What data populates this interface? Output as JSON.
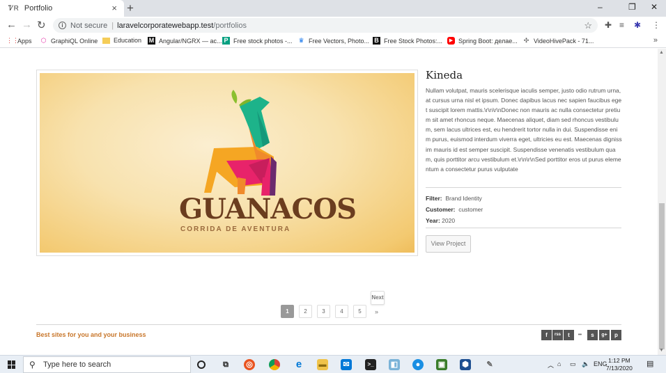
{
  "browser": {
    "tab_title": "Portfolio",
    "tab_close": "×",
    "new_tab": "+",
    "window_controls": [
      "–",
      "❐",
      "✕"
    ],
    "nav": {
      "back": "←",
      "forward": "→",
      "reload": "↻"
    },
    "security_label": "Not secure",
    "url_host": "laravelcorporatewebapp.test",
    "url_path": "/portfolios",
    "bookmarks": [
      {
        "label": "Apps",
        "icon": "apps-grid-icon"
      },
      {
        "label": "GraphiQL Online",
        "icon": "graphql-icon"
      },
      {
        "label": "Education",
        "icon": "folder-icon"
      },
      {
        "label": "Angular/NGRX — ac...",
        "icon": "medium-icon"
      },
      {
        "label": "Free stock photos -...",
        "icon": "pexels-icon"
      },
      {
        "label": "Free Vectors, Photo...",
        "icon": "freepik-icon"
      },
      {
        "label": "Free Stock Photos:...",
        "icon": "burst-icon"
      },
      {
        "label": "Spring Boot: делае...",
        "icon": "youtube-icon"
      },
      {
        "label": "VideoHivePack - 71...",
        "icon": "videohive-icon"
      }
    ],
    "bookmarks_overflow": "»"
  },
  "project": {
    "title": "Kineda",
    "description": "Nullam volutpat, mauris scelerisque iaculis semper, justo odio rutrum urna, at cursus urna nisl et ipsum. Donec dapibus lacus nec sapien faucibus eget suscipit lorem mattis.\\r\\n\\r\\nDonec non mauris ac nulla consectetur pretium sit amet rhoncus neque. Maecenas aliquet, diam sed rhoncus vestibulum, sem lacus ultrices est, eu hendrerit tortor nulla in dui. Suspendisse enim purus, euismod interdum viverra eget, ultricies eu est. Maecenas dignissim mauris id est semper suscipit. Suspendisse venenatis vestibulum quam, quis porttitor arcu vestibulum et.\\r\\n\\r\\nSed porttitor eros ut purus elementum a consectetur purus vulputate",
    "filter_label": "Filter:",
    "filter_value": "Brand Identity",
    "customer_label": "Customer:",
    "customer_value": "customer",
    "year_label": "Year:",
    "year_value": "2020",
    "view_button": "View Project",
    "logo_word": "GUANACOS",
    "logo_sub": "CORRIDA DE AVENTURA"
  },
  "pagination": {
    "next": "Next",
    "pages": [
      "1",
      "2",
      "3",
      "4",
      "5"
    ],
    "active": "1",
    "last": "»"
  },
  "footer": {
    "tagline": "Best sites for you and your business",
    "social": [
      "f",
      "rss",
      "t",
      "••",
      "s",
      "g+",
      "p"
    ]
  },
  "taskbar": {
    "search_placeholder": "Type here to search",
    "language": "ENG",
    "time": "1:12 PM",
    "date": "7/13/2020"
  },
  "colors": {
    "accent": "#c8762a",
    "active_page": "#999999"
  }
}
